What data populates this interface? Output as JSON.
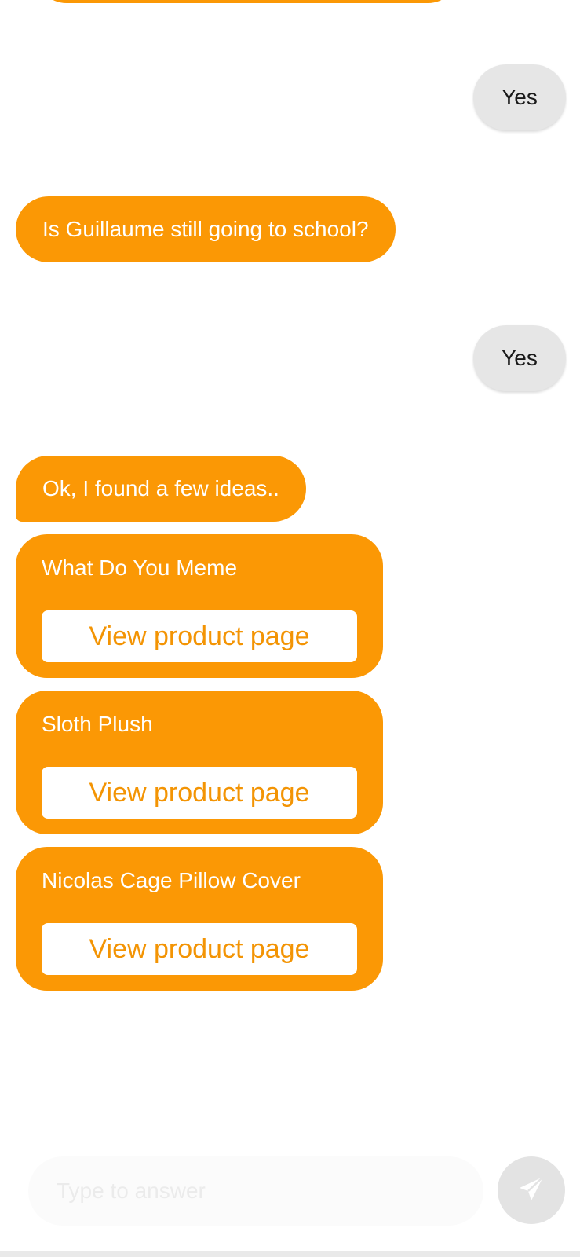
{
  "conversation": {
    "reply_1": "Yes",
    "question": "Is Guillaume still going to school?",
    "reply_2": "Yes",
    "result_intro": "Ok, I found a few ideas.."
  },
  "products": [
    {
      "title": "What Do You Meme",
      "button_label": "View product page"
    },
    {
      "title": "Sloth Plush",
      "button_label": "View product page"
    },
    {
      "title": "Nicolas Cage Pillow Cover",
      "button_label": "View product page"
    }
  ],
  "composer": {
    "placeholder": "Type to answer",
    "value": ""
  },
  "icons": {
    "send": "paper-plane-icon"
  },
  "colors": {
    "accent": "#fb9805",
    "accent_text": "#f39404",
    "user_bubble": "#e6e6e6",
    "send_button": "#e3e3e3"
  }
}
